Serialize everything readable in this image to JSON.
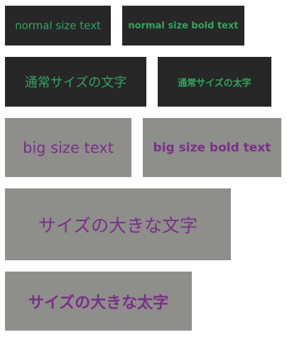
{
  "boxes": {
    "normal_text": "normal size text",
    "normal_bold_text": "normal size bold text",
    "jp_normal_text": "通常サイズの文字",
    "jp_normal_bold_text": "通常サイズの太字",
    "big_text": "big size text",
    "big_bold_text": "big size bold text",
    "jp_big_text": "サイズの大きな文字",
    "jp_big_bold_text": "サイズの大きな太字"
  },
  "colors": {
    "dark_background": "#272727",
    "green_text": "#32a460",
    "gray_background": "#8e8e8a",
    "purple_text": "#7a2f88"
  }
}
